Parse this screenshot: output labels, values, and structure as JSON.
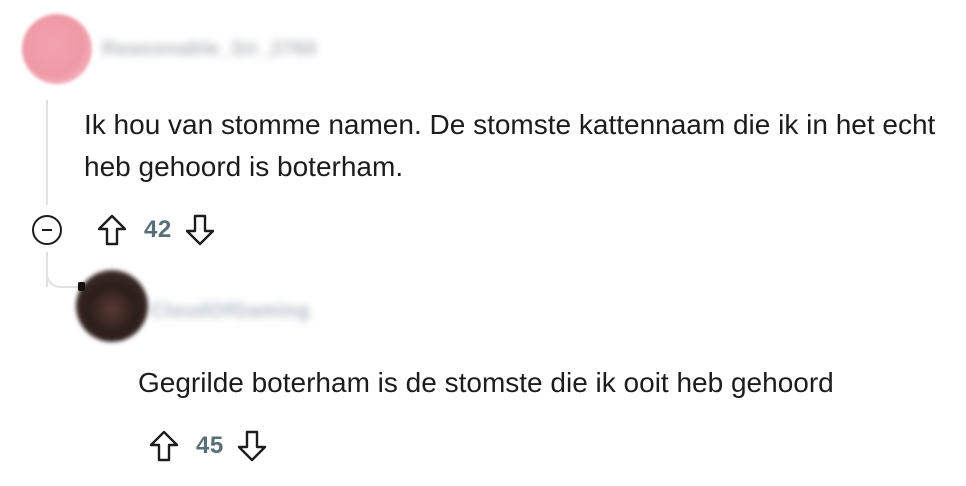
{
  "comments": [
    {
      "username": "Reasonable_Sir_2760",
      "body": "Ik hou van stomme namen. De stomste kattennaam die ik in het echt heb gehoord is boterham.",
      "score": "42"
    },
    {
      "username": "CloudOfGaming",
      "body": "Gegrilde boterham is de stomste die ik ooit heb gehoord",
      "score": "45"
    }
  ],
  "icons": {
    "upvote": "upvote-arrow-icon",
    "downvote": "downvote-arrow-icon",
    "collapse": "collapse-minus-icon"
  },
  "colors": {
    "text": "#1c1c1c",
    "vote_count": "#576f76",
    "thread_line": "#dfe1e3"
  }
}
